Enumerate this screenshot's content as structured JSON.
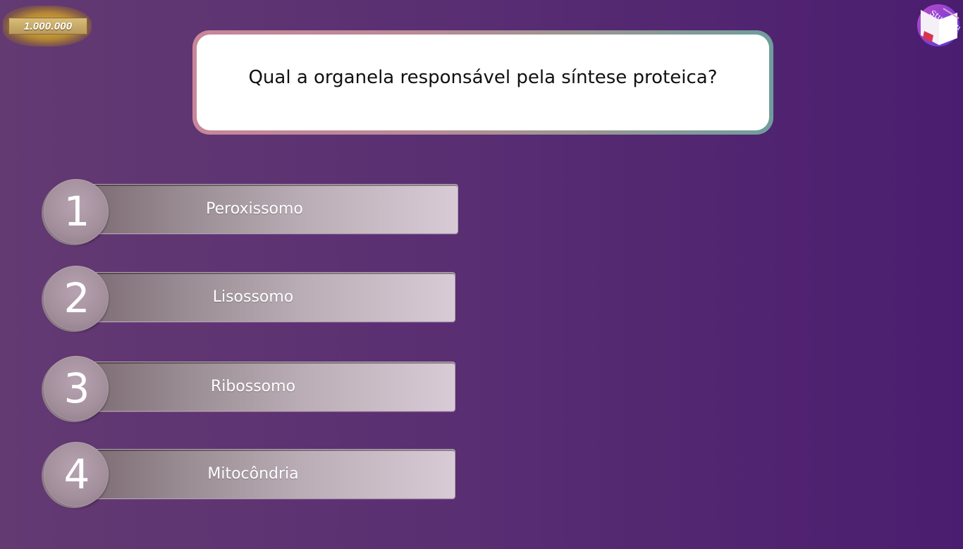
{
  "prize": {
    "amount": "1.000.000"
  },
  "logo": {
    "brand": "StudyDu",
    "icon": "book-logo-icon"
  },
  "question": {
    "text": "Qual a organela responsável pela síntese proteica?"
  },
  "answers": [
    {
      "number": "1",
      "label": "Peroxissomo"
    },
    {
      "number": "2",
      "label": "Lisossomo"
    },
    {
      "number": "3",
      "label": "Ribossomo"
    },
    {
      "number": "4",
      "label": "Mitocôndria"
    }
  ],
  "colors": {
    "background_left": "#633a72",
    "background_right": "#4b1d70",
    "question_border_left": "#c8869a",
    "question_border_right": "#6f9d9c",
    "answer_bar_left": "#7d6a72",
    "answer_bar_right": "#d9cbd6",
    "number_circle": "#a38f9c",
    "prize_gold": "#c4962a"
  }
}
